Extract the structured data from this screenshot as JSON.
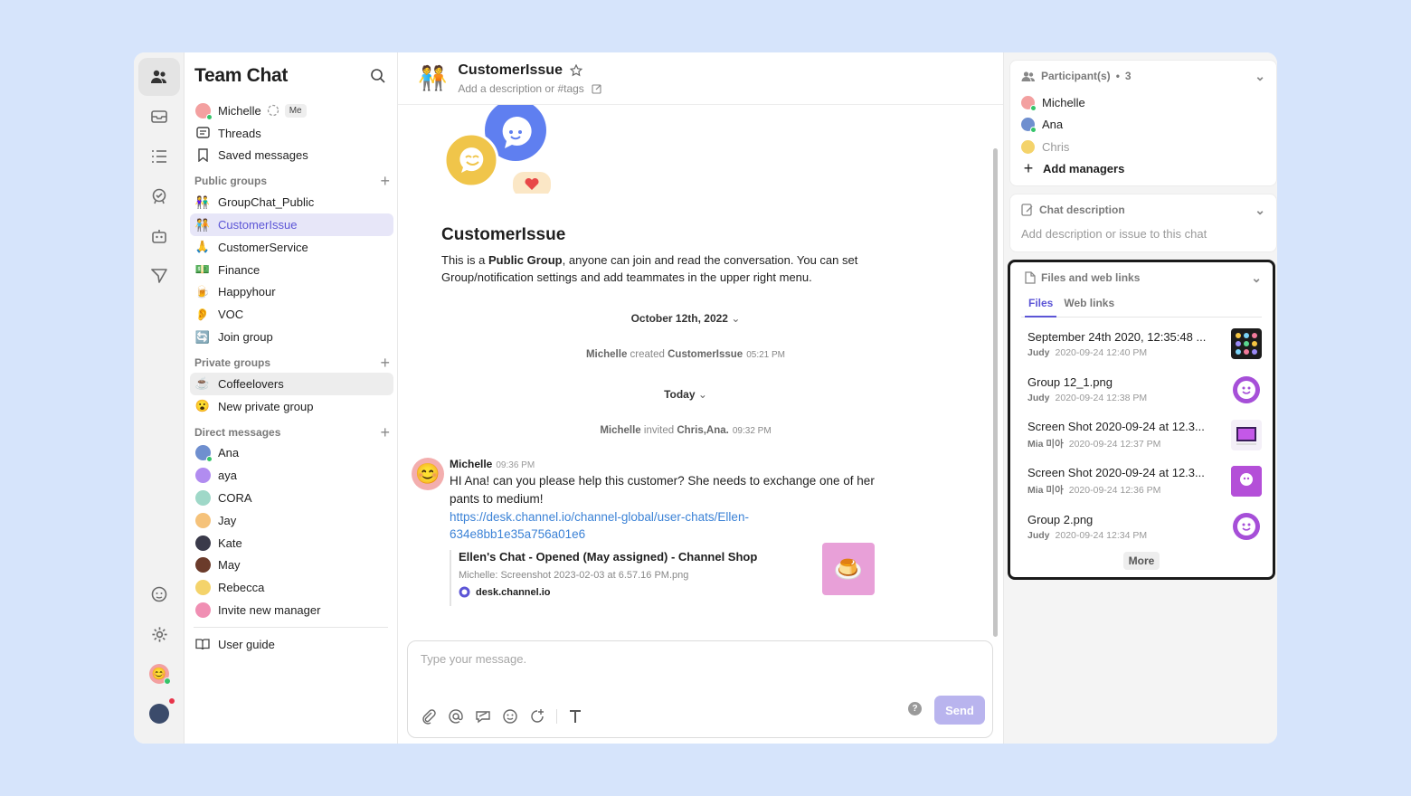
{
  "sidebar": {
    "title": "Team Chat",
    "top_items": [
      {
        "label": "Michelle",
        "badge": "Me"
      },
      {
        "label": "Threads"
      },
      {
        "label": "Saved messages"
      }
    ],
    "public_groups_label": "Public groups",
    "public_groups": [
      {
        "emoji": "👫",
        "label": "GroupChat_Public"
      },
      {
        "emoji": "🧑‍🤝‍🧑",
        "label": "CustomerIssue"
      },
      {
        "emoji": "🙏",
        "label": "CustomerService"
      },
      {
        "emoji": "💵",
        "label": "Finance"
      },
      {
        "emoji": "🍺",
        "label": "Happyhour"
      },
      {
        "emoji": "👂",
        "label": "VOC"
      },
      {
        "emoji": "🔄",
        "label": "Join group"
      }
    ],
    "private_groups_label": "Private groups",
    "private_groups": [
      {
        "emoji": "☕",
        "label": "Coffeelovers"
      },
      {
        "emoji": "😮",
        "label": "New private group"
      }
    ],
    "direct_messages_label": "Direct messages",
    "direct_messages": [
      {
        "label": "Ana",
        "color": "#6f8fcf"
      },
      {
        "label": "aya",
        "color": "#b18cf0"
      },
      {
        "label": "CORA",
        "color": "#9fd8c8"
      },
      {
        "label": "Jay",
        "color": "#f5c27a"
      },
      {
        "label": "Kate",
        "color": "#3a3a4a"
      },
      {
        "label": "May",
        "color": "#6b3b2b"
      },
      {
        "label": "Rebecca",
        "color": "#f4d36b"
      },
      {
        "label": "Invite new manager",
        "color": "#f08fb3"
      }
    ],
    "user_guide": "User guide"
  },
  "channel": {
    "emoji": "🧑‍🤝‍🧑",
    "name": "CustomerIssue",
    "description_placeholder": "Add a description or #tags"
  },
  "feed": {
    "intro_title": "CustomerIssue",
    "intro_pre": "This is a ",
    "intro_bold": "Public Group",
    "intro_post": ", anyone can join and read the conversation. You can set Group/notification settings and add teammates in the upper right menu.",
    "date1": "October 12th, 2022",
    "sys1_actor": "Michelle",
    "sys1_verb": " created ",
    "sys1_target": "CustomerIssue",
    "sys1_time": "05:21 PM",
    "date2": "Today",
    "sys2_actor": "Michelle",
    "sys2_verb": " invited ",
    "sys2_target": "Chris,Ana.",
    "sys2_time": "09:32 PM",
    "message": {
      "author": "Michelle",
      "time": "09:36 PM",
      "text": "HI Ana! can you please help this customer? She needs to exchange one of her pants to medium!",
      "link_line1": "https://desk.channel.io/channel-global/user-chats/Ellen-",
      "link_line2": "634e8bb1e35a756a01e6",
      "preview_title": "Ellen's Chat - Opened (May assigned) - Channel Shop",
      "preview_sub": "Michelle: Screenshot 2023-02-03 at 6.57.16 PM.png",
      "preview_site": "desk.channel.io"
    }
  },
  "composer": {
    "placeholder": "Type your message.",
    "send_label": "Send",
    "help": "?"
  },
  "right_panel": {
    "participants_label": "Participant(s)",
    "participants_count": "3",
    "participants": [
      {
        "name": "Michelle",
        "color": "#f3a0a0",
        "online": true
      },
      {
        "name": "Ana",
        "color": "#6f8fcf",
        "online": true
      },
      {
        "name": "Chris",
        "color": "#f4d36b",
        "online": false
      }
    ],
    "add_managers": "Add managers",
    "chat_description_label": "Chat description",
    "chat_description_placeholder": "Add description or issue to this chat",
    "files_label": "Files and web links",
    "tab_files": "Files",
    "tab_web_links": "Web links",
    "files": [
      {
        "name": "September 24th 2020, 12:35:48 ...",
        "author": "Judy",
        "date": "2020-09-24 12:40 PM",
        "thumb": "#1c1c1c"
      },
      {
        "name": "Group 12_1.png",
        "author": "Judy",
        "date": "2020-09-24 12:38 PM",
        "thumb": "#ffffff"
      },
      {
        "name": "Screen Shot 2020-09-24 at 12.3...",
        "author": "Mia 미아",
        "date": "2020-09-24 12:37 PM",
        "thumb": "#f4f0f8"
      },
      {
        "name": "Screen Shot 2020-09-24 at 12.3...",
        "author": "Mia 미아",
        "date": "2020-09-24 12:36 PM",
        "thumb": "#b44fd8"
      },
      {
        "name": "Group 2.png",
        "author": "Judy",
        "date": "2020-09-24 12:34 PM",
        "thumb": "#ffffff"
      }
    ],
    "more_label": "More"
  }
}
